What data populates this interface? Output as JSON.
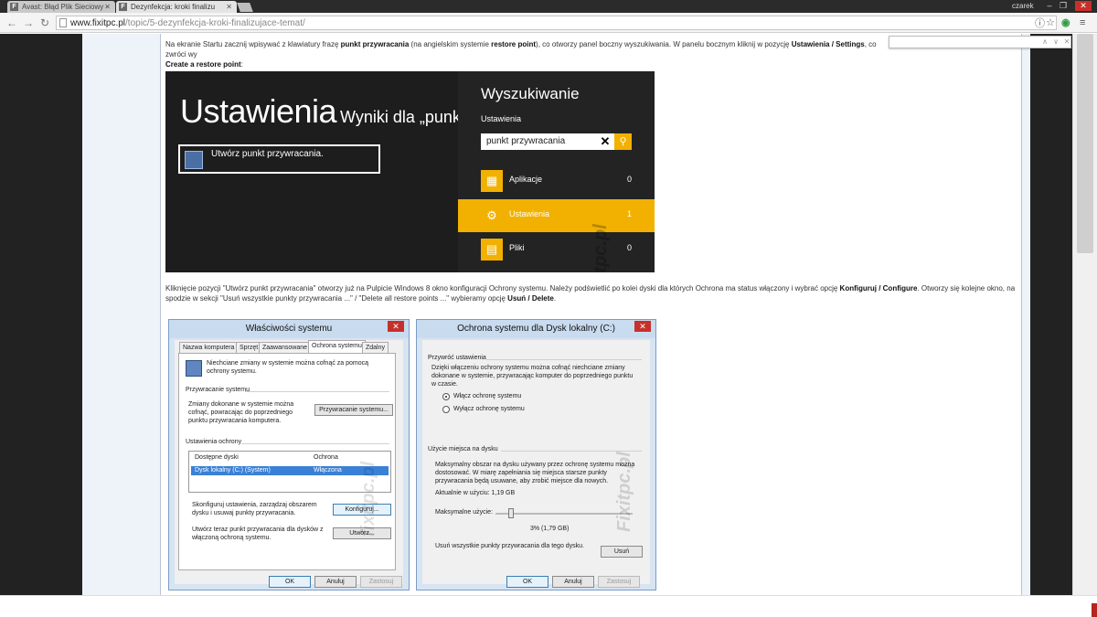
{
  "browser": {
    "tabs": [
      {
        "label": "Avast: Błąd Plik Sieciowy -",
        "active": false
      },
      {
        "label": "Dezynfekcja: kroki finalizu",
        "active": true
      }
    ],
    "user": "czarek",
    "url_host": "www.fixitpc.pl",
    "url_path": "/topic/5-dezynfekcja-kroki-finalizujace-temat/",
    "find_value": ""
  },
  "article": {
    "p1_a": "Na ekranie Startu zacznij wpisywać z klawiatury frazę ",
    "p1_b": "punkt przywracania",
    "p1_c": " (na angielskim systemie ",
    "p1_d": "restore point",
    "p1_e": "), co otworzy panel boczny wyszukiwania. W panelu bocznym kliknij w pozycję ",
    "p1_f": "Ustawienia / Settings",
    "p1_g": ", co zwróci wy",
    "p1_h": "Create a restore point",
    "p1_i": ":",
    "p2_a": "Kliknięcie pozycji \"Utwórz punkt przywracania\" otworzy już na Pulpicie Windows 8 okno konfiguracji Ochrony systemu. Należy podświetlić po kolei dyski dla których Ochrona ma status włączony i wybrać opcję ",
    "p2_b": "Konfiguruj / Configure",
    "p2_c": ". Otworzy się kolejne okno, na spodzie w sekcji \"Usuń wszystkie punkty przywracania ...\" / \"Delete all restore points ...\" wybieramy opcję ",
    "p2_d": "Usuń / Delete",
    "p2_e": "."
  },
  "win8": {
    "title": "Ustawienia",
    "results_for": "Wyniki dla „punkt",
    "result_item": "Utwórz punkt przywracania.",
    "watermark": "Fixitpc.pl",
    "charm_title": "Wyszukiwanie",
    "charm_scope": "Ustawienia",
    "search_query": "punkt przywracania",
    "categories": [
      {
        "label": "Aplikacje",
        "count": "0"
      },
      {
        "label": "Ustawienia",
        "count": "1"
      },
      {
        "label": "Pliki",
        "count": "0"
      }
    ]
  },
  "dlg1": {
    "title": "Właściwości systemu",
    "tabs": [
      "Nazwa komputera",
      "Sprzęt",
      "Zaawansowane",
      "Ochrona systemu",
      "Zdalny"
    ],
    "intro": "Niechciane zmiany w systemie można cofnąć za pomocą ochrony systemu.",
    "restore_header": "Przywracanie systemu",
    "restore_text": "Zmiany dokonane w systemie można cofnąć, powracając do poprzedniego punktu przywracania komputera.",
    "restore_btn": "Przywracanie systemu...",
    "settings_header": "Ustawienia ochrony",
    "col_drives": "Dostępne dyski",
    "col_protection": "Ochrona",
    "drive_name": "Dysk lokalny (C:) (System)",
    "drive_status": "Włączona",
    "configure_text": "Skonfiguruj ustawienia, zarządzaj obszarem dysku i usuwaj punkty przywracania.",
    "configure_btn": "Konfiguruj...",
    "create_text": "Utwórz teraz punkt przywracania dla dysków z włączoną ochroną systemu.",
    "create_btn": "Utwórz...",
    "ok": "OK",
    "cancel": "Anuluj",
    "apply": "Zastosuj"
  },
  "dlg2": {
    "title": "Ochrona systemu dla Dysk lokalny (C:)",
    "restore_header": "Przywróć ustawienia",
    "restore_text": "Dzięki włączeniu ochrony systemu można cofnąć niechciane zmiany dokonane w systemie, przywracając komputer do poprzedniego punktu w czasie.",
    "radio_on": "Włącz ochronę systemu",
    "radio_off": "Wyłącz ochronę systemu",
    "usage_header": "Użycie miejsca na dysku",
    "usage_text": "Maksymalny obszar na dysku używany przez ochronę systemu można dostosować. W miarę zapełniania się miejsca starsze punkty przywracania będą usuwane, aby zrobić miejsce dla nowych.",
    "current_usage": "Aktualnie w użyciu: 1,19 GB",
    "max_usage_label": "Maksymalne użycie:",
    "max_usage_value": "3% (1,79 GB)",
    "max_usage_fraction": 0.03,
    "delete_text": "Usuń wszystkie punkty przywracania dla tego dysku.",
    "delete_btn": "Usuń",
    "ok": "OK",
    "cancel": "Anuluj",
    "apply": "Zastosuj",
    "watermark": "Fixitpc.pl"
  },
  "dlg1_watermark": "fixitpc.pl"
}
